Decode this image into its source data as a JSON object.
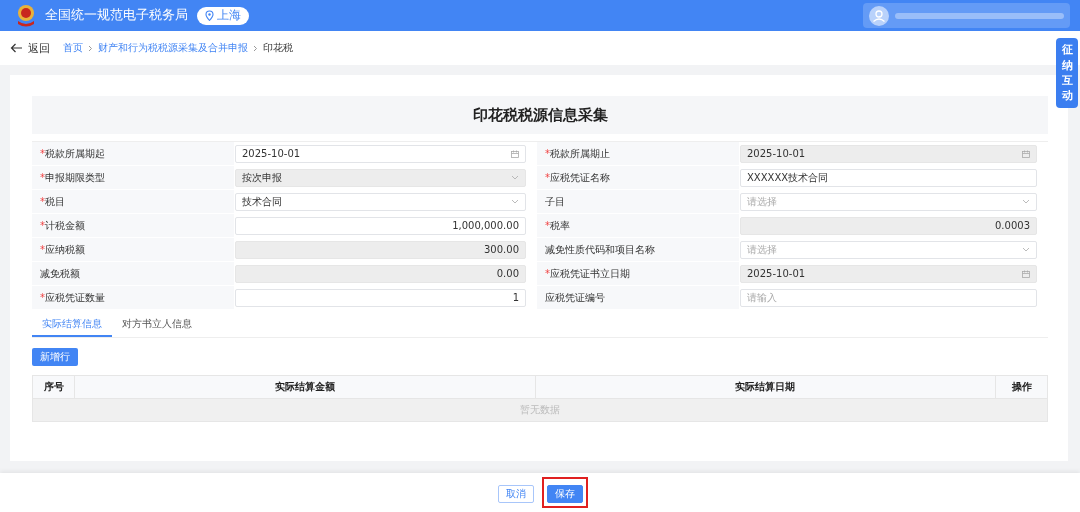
{
  "header": {
    "site_title": "全国统一规范电子税务局",
    "region": "上海"
  },
  "breadcrumb": {
    "back": "返回",
    "items": [
      {
        "label": "首页",
        "link": true
      },
      {
        "label": "财产和行为税税源采集及合并申报",
        "link": true
      },
      {
        "label": "印花税",
        "link": false
      }
    ]
  },
  "side_tab": {
    "label": "征纳互动"
  },
  "form": {
    "title": "印花税税源信息采集",
    "rows": [
      [
        {
          "required_mark": "*",
          "label": "税款所属期起",
          "kind": "date",
          "value": "2025-10-01",
          "disabled": false
        },
        {
          "required_mark": "*",
          "label": "税款所属期止",
          "kind": "date",
          "value": "2025-10-01",
          "disabled": true
        }
      ],
      [
        {
          "required_mark": "*",
          "label": "申报期限类型",
          "kind": "select",
          "value": "按次申报",
          "disabled": true
        },
        {
          "required_mark": "*",
          "label": "应税凭证名称",
          "kind": "text",
          "value": "XXXXXX技术合同",
          "disabled": false
        }
      ],
      [
        {
          "required_mark": "*",
          "label": "税目",
          "kind": "select",
          "value": "技术合同",
          "disabled": false
        },
        {
          "label": "子目",
          "kind": "select",
          "placeholder": "请选择",
          "disabled": false
        }
      ],
      [
        {
          "required_mark": "*",
          "label": "计税金额",
          "kind": "number",
          "value": "1,000,000.00",
          "disabled": false
        },
        {
          "required_mark": "*",
          "label": "税率",
          "kind": "number",
          "value": "0.0003",
          "disabled": true
        }
      ],
      [
        {
          "required_mark": "*",
          "label": "应纳税额",
          "kind": "number",
          "value": "300.00",
          "disabled": true
        },
        {
          "label": "减免性质代码和项目名称",
          "kind": "select",
          "placeholder": "请选择",
          "disabled": false
        }
      ],
      [
        {
          "label": "减免税额",
          "kind": "number",
          "value": "0.00",
          "disabled": true
        },
        {
          "required_mark": "*",
          "label": "应税凭证书立日期",
          "kind": "date",
          "value": "2025-10-01",
          "disabled": true
        }
      ],
      [
        {
          "required_mark": "*",
          "label": "应税凭证数量",
          "kind": "number",
          "value": "1",
          "disabled": false
        },
        {
          "label": "应税凭证编号",
          "kind": "text",
          "placeholder": "请输入",
          "disabled": false
        }
      ]
    ]
  },
  "tabs": [
    {
      "label": "实际结算信息",
      "selected": true
    },
    {
      "label": "对方书立人信息",
      "selected": false
    }
  ],
  "add_row_button": "新增行",
  "table": {
    "columns": [
      "序号",
      "实际结算金额",
      "实际结算日期",
      "操作"
    ],
    "empty_text": "暂无数据"
  },
  "footer": {
    "buttons": [
      {
        "label": "取消",
        "kind": "secondary",
        "highlighted": false
      },
      {
        "label": "保存",
        "kind": "primary",
        "highlighted": true
      }
    ]
  }
}
